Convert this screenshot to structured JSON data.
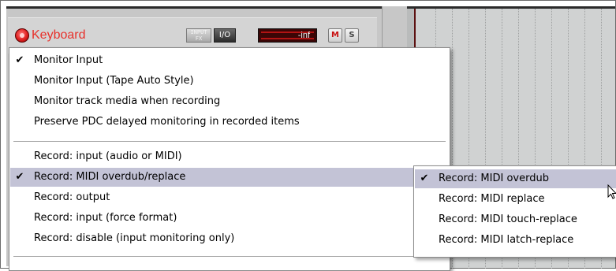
{
  "track": {
    "name": "Keyboard",
    "input_fx_label": "INPUT\nFX",
    "io_label": "I/O",
    "meter_value": "-inf",
    "mute_label": "M",
    "solo_label": "S"
  },
  "main_menu": {
    "group1": [
      {
        "label": "Monitor Input",
        "checked": true
      },
      {
        "label": "Monitor Input (Tape Auto Style)",
        "checked": false
      },
      {
        "label": "Monitor track media when recording",
        "checked": false
      },
      {
        "label": "Preserve PDC delayed monitoring in recorded items",
        "checked": false
      }
    ],
    "group2": [
      {
        "label": "Record: input (audio or MIDI)",
        "checked": false,
        "submenu": false
      },
      {
        "label": "Record: MIDI overdub/replace",
        "checked": true,
        "submenu": true,
        "highlighted": true
      },
      {
        "label": "Record: output",
        "checked": false,
        "submenu": true
      },
      {
        "label": "Record: input (force format)",
        "checked": false,
        "submenu": true
      },
      {
        "label": "Record: disable (input monitoring only)",
        "checked": false,
        "submenu": false
      }
    ]
  },
  "sub_menu": {
    "items": [
      {
        "label": "Record: MIDI overdub",
        "checked": true
      },
      {
        "label": "Record: MIDI replace",
        "checked": false
      },
      {
        "label": "Record: MIDI touch-replace",
        "checked": false
      },
      {
        "label": "Record: MIDI latch-replace",
        "checked": false
      }
    ]
  },
  "icons": {
    "check": "✔",
    "record_arm": "record-arm-icon",
    "submenu_arrow": "chevron-right-icon",
    "cursor": "mouse-pointer-icon"
  },
  "colors": {
    "track_name": "#e8302a",
    "menu_highlight": "#c3c3d6",
    "arrange_bg": "#d0d2d2"
  }
}
